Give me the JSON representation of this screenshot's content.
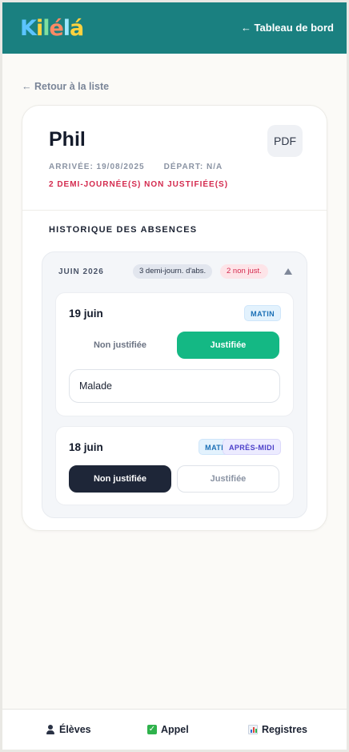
{
  "header": {
    "logo_text": "Kilélá",
    "dashboard_link": "← Tableau de bord"
  },
  "back_link": "← Retour à la liste",
  "student": {
    "name": "Phil",
    "pdf_label": "PDF",
    "arrival": "ARRIVÉE: 19/08/2025",
    "departure": "DÉPART: N/A",
    "alert": "2 DEMI-JOURNÉE(S) NON JUSTIFIÉE(S)"
  },
  "history": {
    "title": "HISTORIQUE DES ABSENCES",
    "month": {
      "label": "JUIN 2026",
      "count_badge": "3 demi-journ. d'abs.",
      "unjustified_badge": "2 non just.",
      "days": [
        {
          "date": "19 juin",
          "tags": [
            "MATIN"
          ],
          "option_unjustified": "Non justifiée",
          "option_justified": "Justifiée",
          "selected": "justified",
          "reason": "Malade"
        },
        {
          "date": "18 juin",
          "tags": [
            "MATIN",
            "APRÈS-MIDI"
          ],
          "option_unjustified": "Non justifiée",
          "option_justified": "Justifiée",
          "selected": "unjustified"
        }
      ]
    }
  },
  "bottom_nav": {
    "students": "Élèves",
    "attendance": "Appel",
    "registers": "Registres"
  },
  "colors": {
    "header": "#1a8080",
    "justified_active": "#14b884",
    "unjustified_active": "#1e2638",
    "alert": "#d42a4e"
  },
  "icons": {
    "students": "person-icon",
    "attendance": "checkbox-icon",
    "registers": "bar-chart-icon"
  }
}
